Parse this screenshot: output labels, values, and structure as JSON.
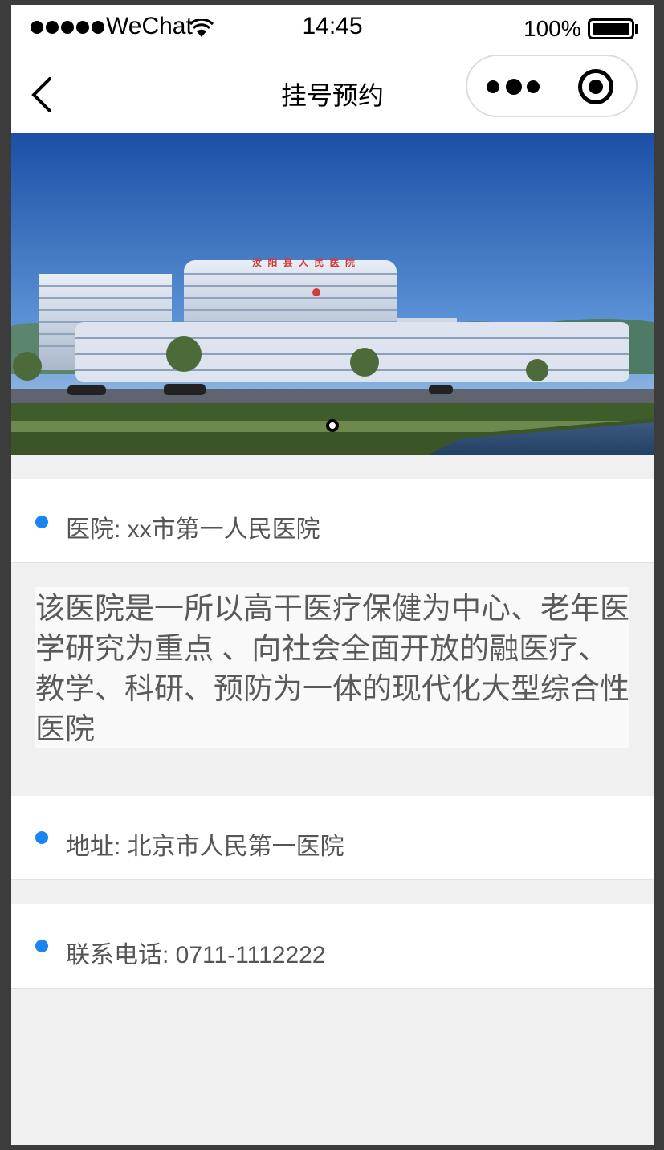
{
  "status_bar": {
    "carrier": "WeChat",
    "time": "14:45",
    "battery": "100%"
  },
  "nav": {
    "title": "挂号预约"
  },
  "banner": {
    "sign_text": "汝 阳 县 人 民 医 院",
    "slide_count": 1,
    "active_slide": 1
  },
  "hospital": {
    "label": "医院: xx市第一人民医院"
  },
  "description": "该医院是一所以高干医疗保健为中心、老年医学研究为重点 、向社会全面开放的融医疗、教学、科研、预防为一体的现代化大型综合性医院",
  "address": {
    "label": "地址: 北京市人民第一医院"
  },
  "phone": {
    "label": "联系电话: 0711-1112222"
  },
  "colors": {
    "bullet": "#1a85f0",
    "page_bg": "#f0f0f0"
  }
}
